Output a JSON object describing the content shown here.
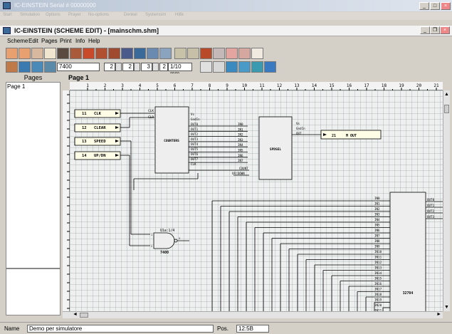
{
  "window": {
    "title": "IC-EINSTEIN  Serial # 00000000"
  },
  "top_menu": [
    "Start",
    "Simulation",
    "Options",
    "Prayer",
    "No-options",
    "Denkel",
    "Systemsim",
    "Hilfe"
  ],
  "doc": {
    "title": "IC-EINSTEIN (SCHEME EDIT) - [mainschm.shm]"
  },
  "menu": [
    "Scheme",
    "Edit",
    "Pages",
    "Print",
    "Info",
    "Help"
  ],
  "toolbar": {
    "field1": "7400",
    "field2": "2",
    "field3": "2",
    "field4": "3",
    "field5": "2",
    "scale": "1/10 mm..."
  },
  "pages_pane": {
    "header": "Pages",
    "items": [
      "Page  1"
    ]
  },
  "page_header": "Page  1",
  "ruler": [
    "1",
    "2",
    "3",
    "4",
    "5",
    "6",
    "7",
    "8",
    "9",
    "10",
    "11",
    "12",
    "13",
    "14",
    "15",
    "16",
    "17",
    "18",
    "19",
    "20",
    "21",
    "22"
  ],
  "schematic": {
    "inputs": [
      {
        "num": "11",
        "label": "CLK"
      },
      {
        "num": "12",
        "label": "CLEAR"
      },
      {
        "num": "13",
        "label": "SPEED"
      },
      {
        "num": "14",
        "label": "UP/DN"
      }
    ],
    "counter": {
      "name": "COUNTERS",
      "in_pins": [
        "CLK",
        "CLR"
      ],
      "out_pins": [
        "Vs",
        "GndIn",
        "OUT0",
        "OUT1",
        "OUT2",
        "OUT3",
        "OUT4",
        "OUT5",
        "OUT6",
        "OUT7",
        "CLK"
      ],
      "bus_pins": [
        "IN0",
        "IN1",
        "IN2",
        "IN3",
        "IN4",
        "IN5",
        "IN6",
        "IN7"
      ],
      "extra": [
        "COUNT",
        "UP/DOWN"
      ]
    },
    "mux": {
      "name": "SPDSEL",
      "pins": [
        "Vs",
        "GndIn",
        "OUT"
      ]
    },
    "output": {
      "num": "21",
      "label": "M OUT"
    },
    "gate": {
      "top": "U1a:1/4",
      "bottom": "7400"
    },
    "ic": {
      "name": "32704",
      "in_pins": [
        "IN0",
        "IN1",
        "IN2",
        "IN3",
        "IN4",
        "IN5",
        "IN6",
        "IN7",
        "IN8",
        "IN9",
        "IN10",
        "IN11",
        "IN12",
        "IN13",
        "IN14",
        "IN15",
        "IN16",
        "IN17",
        "IN18",
        "IN19",
        "IN20",
        "IN21",
        "IN22"
      ],
      "out_pins": [
        "OUT0",
        "OUT1",
        "OUT2",
        "OUT3"
      ]
    }
  },
  "status": {
    "name_label": "Name",
    "name_value": "Demo per simulatore",
    "pos_label": "Pos.",
    "pos_value": "12:5B"
  },
  "colors": {
    "wire": "#000000",
    "ic_fill": "#eeeeee",
    "label_fill": "#fffde6",
    "accent": "#bfa54a"
  }
}
